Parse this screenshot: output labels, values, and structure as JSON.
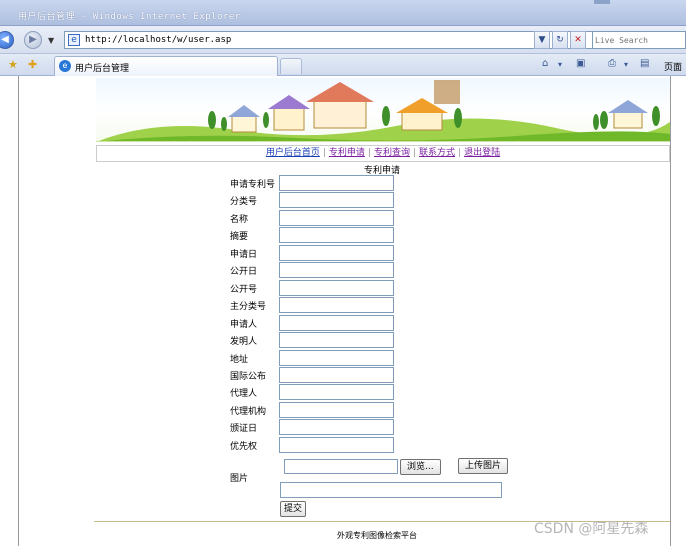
{
  "window": {
    "title": "用户后台管理 - Windows Internet Explorer"
  },
  "address_bar": {
    "url": "http://localhost/w/user.asp",
    "search_placeholder": "Live Search"
  },
  "tabs": [
    {
      "label": "用户后台管理"
    }
  ],
  "command_bar": {
    "page_label": "页面"
  },
  "nav_links": [
    "用户后台首页",
    "专利申请",
    "专利查询",
    "联系方式",
    "退出登陆"
  ],
  "form": {
    "title": "专利申请",
    "fields": [
      {
        "label": "申请专利号",
        "value": ""
      },
      {
        "label": "分类号",
        "value": ""
      },
      {
        "label": "名称",
        "value": ""
      },
      {
        "label": "摘要",
        "value": ""
      },
      {
        "label": "申请日",
        "value": ""
      },
      {
        "label": "公开日",
        "value": ""
      },
      {
        "label": "公开号",
        "value": ""
      },
      {
        "label": "主分类号",
        "value": ""
      },
      {
        "label": "申请人",
        "value": ""
      },
      {
        "label": "发明人",
        "value": ""
      },
      {
        "label": "地址",
        "value": ""
      },
      {
        "label": "国际公布",
        "value": ""
      },
      {
        "label": "代理人",
        "value": ""
      },
      {
        "label": "代理机构",
        "value": ""
      },
      {
        "label": "颁证日",
        "value": ""
      },
      {
        "label": "优先权",
        "value": ""
      }
    ],
    "image_label": "图片",
    "browse_button": "浏览...",
    "upload_button": "上传图片",
    "submit_button": "提交"
  },
  "footer": {
    "text": "外观专利图像检索平台"
  },
  "watermark": "CSDN @阿星先森"
}
